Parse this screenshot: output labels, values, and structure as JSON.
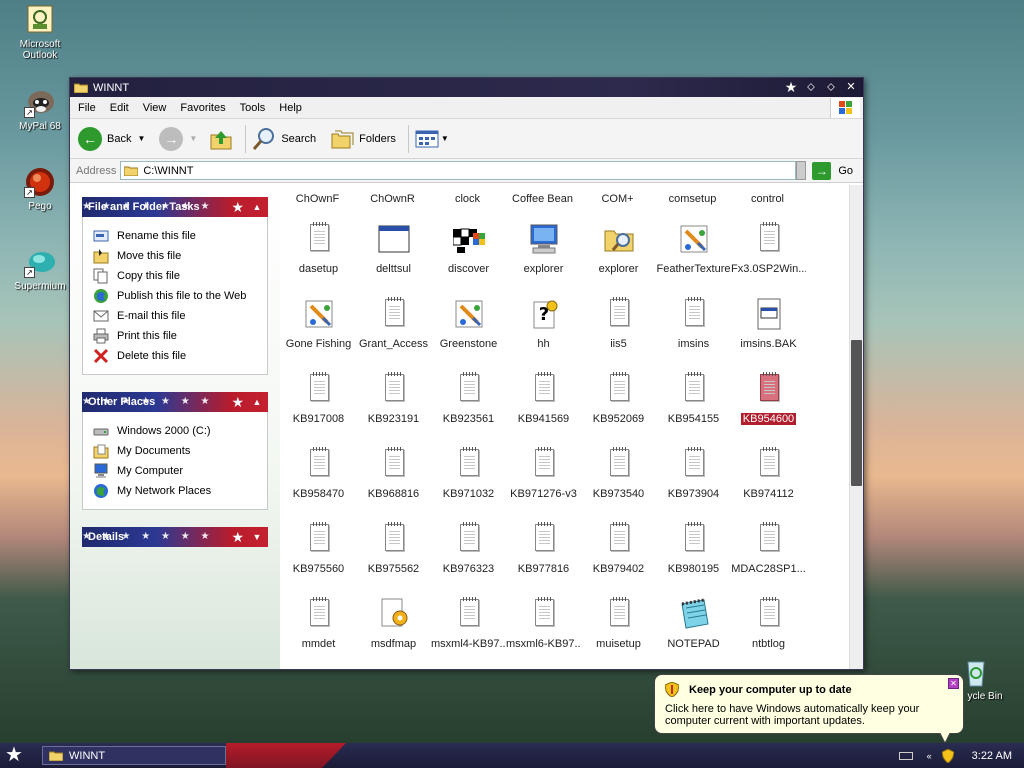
{
  "desktop": {
    "icons": [
      {
        "label": "Microsoft Outlook",
        "icon": "outlook-icon"
      },
      {
        "label": "MyPal 68",
        "icon": "raccoon-icon"
      },
      {
        "label": "Pego",
        "icon": "red-orb-icon"
      },
      {
        "label": "Supermium",
        "icon": "supermium-icon"
      }
    ],
    "recycle_bin_label": "ycle Bin"
  },
  "window": {
    "title": "WINNT",
    "menu": [
      "File",
      "Edit",
      "View",
      "Favorites",
      "Tools",
      "Help"
    ],
    "toolbar": {
      "back": "Back",
      "search": "Search",
      "folders": "Folders"
    },
    "address": {
      "label": "Address",
      "value": "C:\\WINNT",
      "go": "Go"
    }
  },
  "left_pane": {
    "file_tasks": {
      "title": "File and Folder Tasks",
      "items": [
        {
          "label": "Rename this file",
          "icon": "rename-icon"
        },
        {
          "label": "Move this file",
          "icon": "move-icon"
        },
        {
          "label": "Copy this file",
          "icon": "copy-icon"
        },
        {
          "label": "Publish this file to the Web",
          "icon": "publish-web-icon"
        },
        {
          "label": "E-mail this file",
          "icon": "email-icon"
        },
        {
          "label": "Print this file",
          "icon": "print-icon"
        },
        {
          "label": "Delete this file",
          "icon": "delete-icon"
        }
      ]
    },
    "other_places": {
      "title": "Other Places",
      "items": [
        {
          "label": "Windows 2000 (C:)",
          "icon": "drive-icon"
        },
        {
          "label": "My Documents",
          "icon": "my-documents-icon"
        },
        {
          "label": "My Computer",
          "icon": "my-computer-icon"
        },
        {
          "label": "My Network Places",
          "icon": "network-places-icon"
        }
      ]
    },
    "details": {
      "title": "Details"
    }
  },
  "content": {
    "top_row": [
      "ChOwnF",
      "ChOwnR",
      "clock",
      "Coffee Bean",
      "COM+",
      "comsetup",
      "control"
    ],
    "files": [
      {
        "name": "dasetup",
        "icon": "doc"
      },
      {
        "name": "delttsul",
        "icon": "window"
      },
      {
        "name": "discover",
        "icon": "discover"
      },
      {
        "name": "explorer",
        "icon": "computer"
      },
      {
        "name": "explorer",
        "icon": "search-folder"
      },
      {
        "name": "FeatherTexture",
        "icon": "paint"
      },
      {
        "name": "Fx3.0SP2Win...",
        "icon": "doc"
      },
      {
        "name": "Gone Fishing",
        "icon": "paint"
      },
      {
        "name": "Grant_Access",
        "icon": "doc"
      },
      {
        "name": "Greenstone",
        "icon": "paint"
      },
      {
        "name": "hh",
        "icon": "help"
      },
      {
        "name": "iis5",
        "icon": "doc"
      },
      {
        "name": "imsins",
        "icon": "doc"
      },
      {
        "name": "imsins.BAK",
        "icon": "bak"
      },
      {
        "name": "KB917008",
        "icon": "doc"
      },
      {
        "name": "KB923191",
        "icon": "doc"
      },
      {
        "name": "KB923561",
        "icon": "doc"
      },
      {
        "name": "KB941569",
        "icon": "doc"
      },
      {
        "name": "KB952069",
        "icon": "doc"
      },
      {
        "name": "KB954155",
        "icon": "doc"
      },
      {
        "name": "KB954600",
        "icon": "doc-pink",
        "selected": true
      },
      {
        "name": "KB958470",
        "icon": "doc"
      },
      {
        "name": "KB968816",
        "icon": "doc"
      },
      {
        "name": "KB971032",
        "icon": "doc"
      },
      {
        "name": "KB971276-v3",
        "icon": "doc"
      },
      {
        "name": "KB973540",
        "icon": "doc"
      },
      {
        "name": "KB973904",
        "icon": "doc"
      },
      {
        "name": "KB974112",
        "icon": "doc"
      },
      {
        "name": "KB975560",
        "icon": "doc"
      },
      {
        "name": "KB975562",
        "icon": "doc"
      },
      {
        "name": "KB976323",
        "icon": "doc"
      },
      {
        "name": "KB977816",
        "icon": "doc"
      },
      {
        "name": "KB979402",
        "icon": "doc"
      },
      {
        "name": "KB980195",
        "icon": "doc"
      },
      {
        "name": "MDAC28SP1...",
        "icon": "doc"
      },
      {
        "name": "mmdet",
        "icon": "doc"
      },
      {
        "name": "msdfmap",
        "icon": "gear-doc"
      },
      {
        "name": "msxml4-KB97...",
        "icon": "doc"
      },
      {
        "name": "msxml6-KB97...",
        "icon": "doc"
      },
      {
        "name": "muisetup",
        "icon": "doc"
      },
      {
        "name": "NOTEPAD",
        "icon": "notepad"
      },
      {
        "name": "ntbtlog",
        "icon": "doc"
      }
    ]
  },
  "taskbar": {
    "task": "WINNT",
    "clock": "3:22 AM"
  },
  "balloon": {
    "title": "Keep your computer up to date",
    "text": "Click here to have Windows automatically keep your computer current with important updates."
  }
}
